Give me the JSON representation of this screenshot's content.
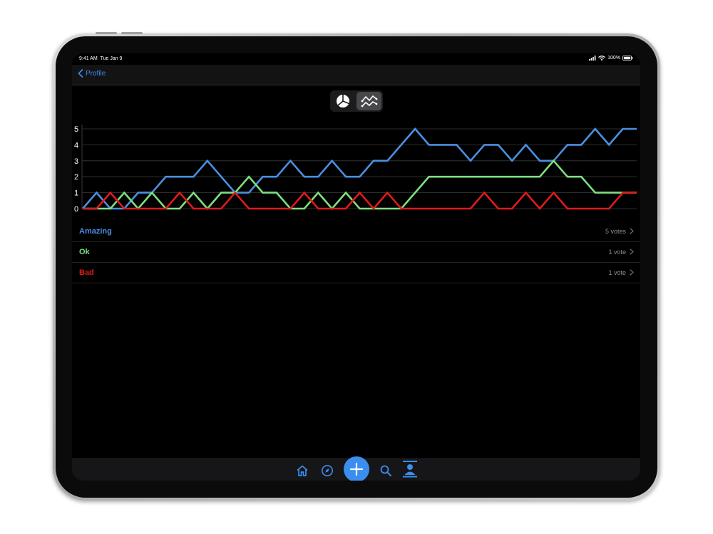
{
  "status_bar": {
    "time": "9:41 AM",
    "date": "Tue Jan 9",
    "battery": "100%"
  },
  "nav": {
    "back_label": "Profile",
    "back_icon": "chevron-left-icon"
  },
  "segmented_control": {
    "options": [
      {
        "icon": "pie-chart-icon",
        "selected": false
      },
      {
        "icon": "line-chart-icon",
        "selected": true
      }
    ]
  },
  "chart_data": {
    "type": "line",
    "ylim": [
      0,
      5
    ],
    "yticks": [
      "0",
      "1",
      "2",
      "3",
      "4",
      "5"
    ],
    "x": [
      0,
      1,
      2,
      3,
      4,
      5,
      6,
      7,
      8,
      9,
      10,
      11,
      12,
      13,
      14,
      15,
      16,
      17,
      18,
      19,
      20,
      21,
      22,
      23,
      24,
      25,
      26,
      27,
      28,
      29,
      30,
      31,
      32,
      33,
      34,
      35,
      36,
      37,
      38,
      39,
      40
    ],
    "series": [
      {
        "name": "Amazing",
        "color": "#4a90e2",
        "values": [
          0,
          1,
          0,
          0,
          1,
          1,
          2,
          2,
          2,
          3,
          2,
          1,
          1,
          2,
          2,
          3,
          2,
          2,
          3,
          2,
          2,
          3,
          3,
          4,
          5,
          4,
          4,
          4,
          3,
          4,
          4,
          3,
          4,
          3,
          3,
          4,
          4,
          5,
          4,
          5,
          5
        ]
      },
      {
        "name": "Ok",
        "color": "#7ee07e",
        "values": [
          0,
          0,
          0,
          1,
          0,
          1,
          0,
          0,
          1,
          0,
          1,
          1,
          2,
          1,
          1,
          0,
          0,
          1,
          0,
          1,
          0,
          0,
          0,
          0,
          1,
          2,
          2,
          2,
          2,
          2,
          2,
          2,
          2,
          2,
          3,
          2,
          2,
          1,
          1,
          1,
          1
        ]
      },
      {
        "name": "Bad",
        "color": "#e01b1b",
        "values": [
          0,
          0,
          1,
          0,
          0,
          0,
          0,
          1,
          0,
          0,
          0,
          1,
          0,
          0,
          0,
          0,
          1,
          0,
          0,
          0,
          1,
          0,
          1,
          0,
          0,
          0,
          0,
          0,
          0,
          1,
          0,
          0,
          1,
          0,
          1,
          0,
          0,
          0,
          0,
          1,
          1
        ]
      }
    ]
  },
  "results": [
    {
      "label": "Amazing",
      "count": "5 votes",
      "color": "#4a90e2"
    },
    {
      "label": "Ok",
      "count": "1 vote",
      "color": "#7ee07e"
    },
    {
      "label": "Bad",
      "count": "1 vote",
      "color": "#e01b1b"
    }
  ],
  "tab_bar": {
    "items": [
      "home-icon",
      "compass-icon",
      "plus-icon",
      "search-icon",
      "profile-icon"
    ],
    "accent": "#3b8ef0"
  }
}
